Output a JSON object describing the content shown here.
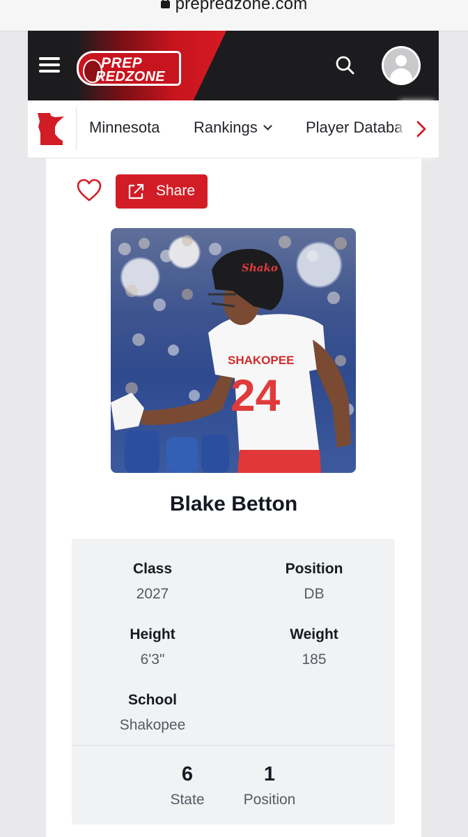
{
  "browser": {
    "url": "prepredzone.com"
  },
  "header": {
    "logo_line1": "PREP",
    "logo_line2": "REDZONE",
    "icons": [
      "menu-icon",
      "search-icon",
      "user-avatar-icon"
    ],
    "colors": {
      "brand_red": "#d21d26",
      "header_dark": "#1c1c1f"
    }
  },
  "nav": {
    "state_icon": "minnesota-state-icon",
    "items": [
      {
        "label": "Minnesota"
      },
      {
        "label": "Rankings"
      },
      {
        "label": "Player Databa"
      }
    ],
    "next_icon": "chevron-right-icon"
  },
  "actions": {
    "favorite_icon": "heart-icon",
    "share_label": "Share",
    "share_icon": "external-link-icon"
  },
  "player": {
    "name": "Blake Betton",
    "photo": {
      "helmet_text": "Shako",
      "jersey_text": "SHAKOPEE",
      "jersey_number": "24"
    },
    "details": [
      {
        "label": "Class",
        "value": "2027"
      },
      {
        "label": "Position",
        "value": "DB"
      },
      {
        "label": "Height",
        "value": "6'3\""
      },
      {
        "label": "Weight",
        "value": "185"
      },
      {
        "label": "School",
        "value": "Shakopee"
      }
    ],
    "rankings": [
      {
        "rank": "6",
        "label": "State"
      },
      {
        "rank": "1",
        "label": "Position"
      }
    ]
  }
}
